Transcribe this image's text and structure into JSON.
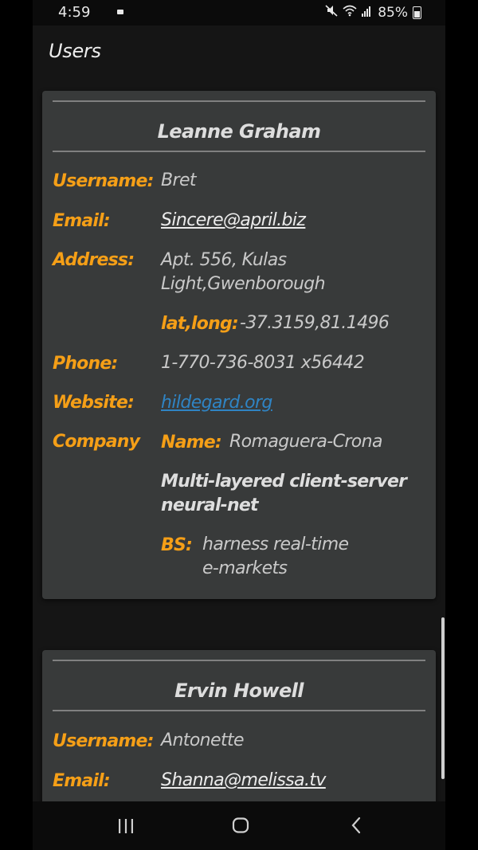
{
  "status_bar": {
    "time": "4:59",
    "battery": "85%",
    "icons": [
      "notification-dot-icon",
      "mute-icon",
      "wifi-icon",
      "signal-icon",
      "battery-icon"
    ]
  },
  "app_bar": {
    "title": "Users"
  },
  "users": [
    {
      "name": "Leanne Graham",
      "username_label": "Username:",
      "username": "Bret",
      "email_label": "Email:",
      "email": "Sincere@april.biz",
      "address_label": "Address:",
      "address_line1": "Apt. 556, Kulas",
      "address_line2": "Light,Gwenborough",
      "latlong_label": "lat,long:",
      "latlong": "-37.3159,81.1496",
      "phone_label": "Phone:",
      "phone": "1-770-736-8031 x56442",
      "website_label": "Website:",
      "website": "hildegard.org",
      "company_label": "Company",
      "company_name_label": "Name:",
      "company_name": "Romaguera-Crona",
      "catch_line1": "Multi-layered client-server",
      "catch_line2": "neural-net",
      "bs_label": "BS:",
      "bs_line1": "harness real-time",
      "bs_line2": "e-markets"
    },
    {
      "name": "Ervin Howell",
      "username_label": "Username:",
      "username": "Antonette",
      "email_label": "Email:",
      "email": "Shanna@melissa.tv"
    }
  ],
  "colors": {
    "accent_label": "#f59f17",
    "card_bg": "#383a3a",
    "link_blue": "#2f84c4"
  },
  "nav_bar": {
    "icons": [
      "recents-icon",
      "home-icon",
      "back-icon"
    ]
  }
}
